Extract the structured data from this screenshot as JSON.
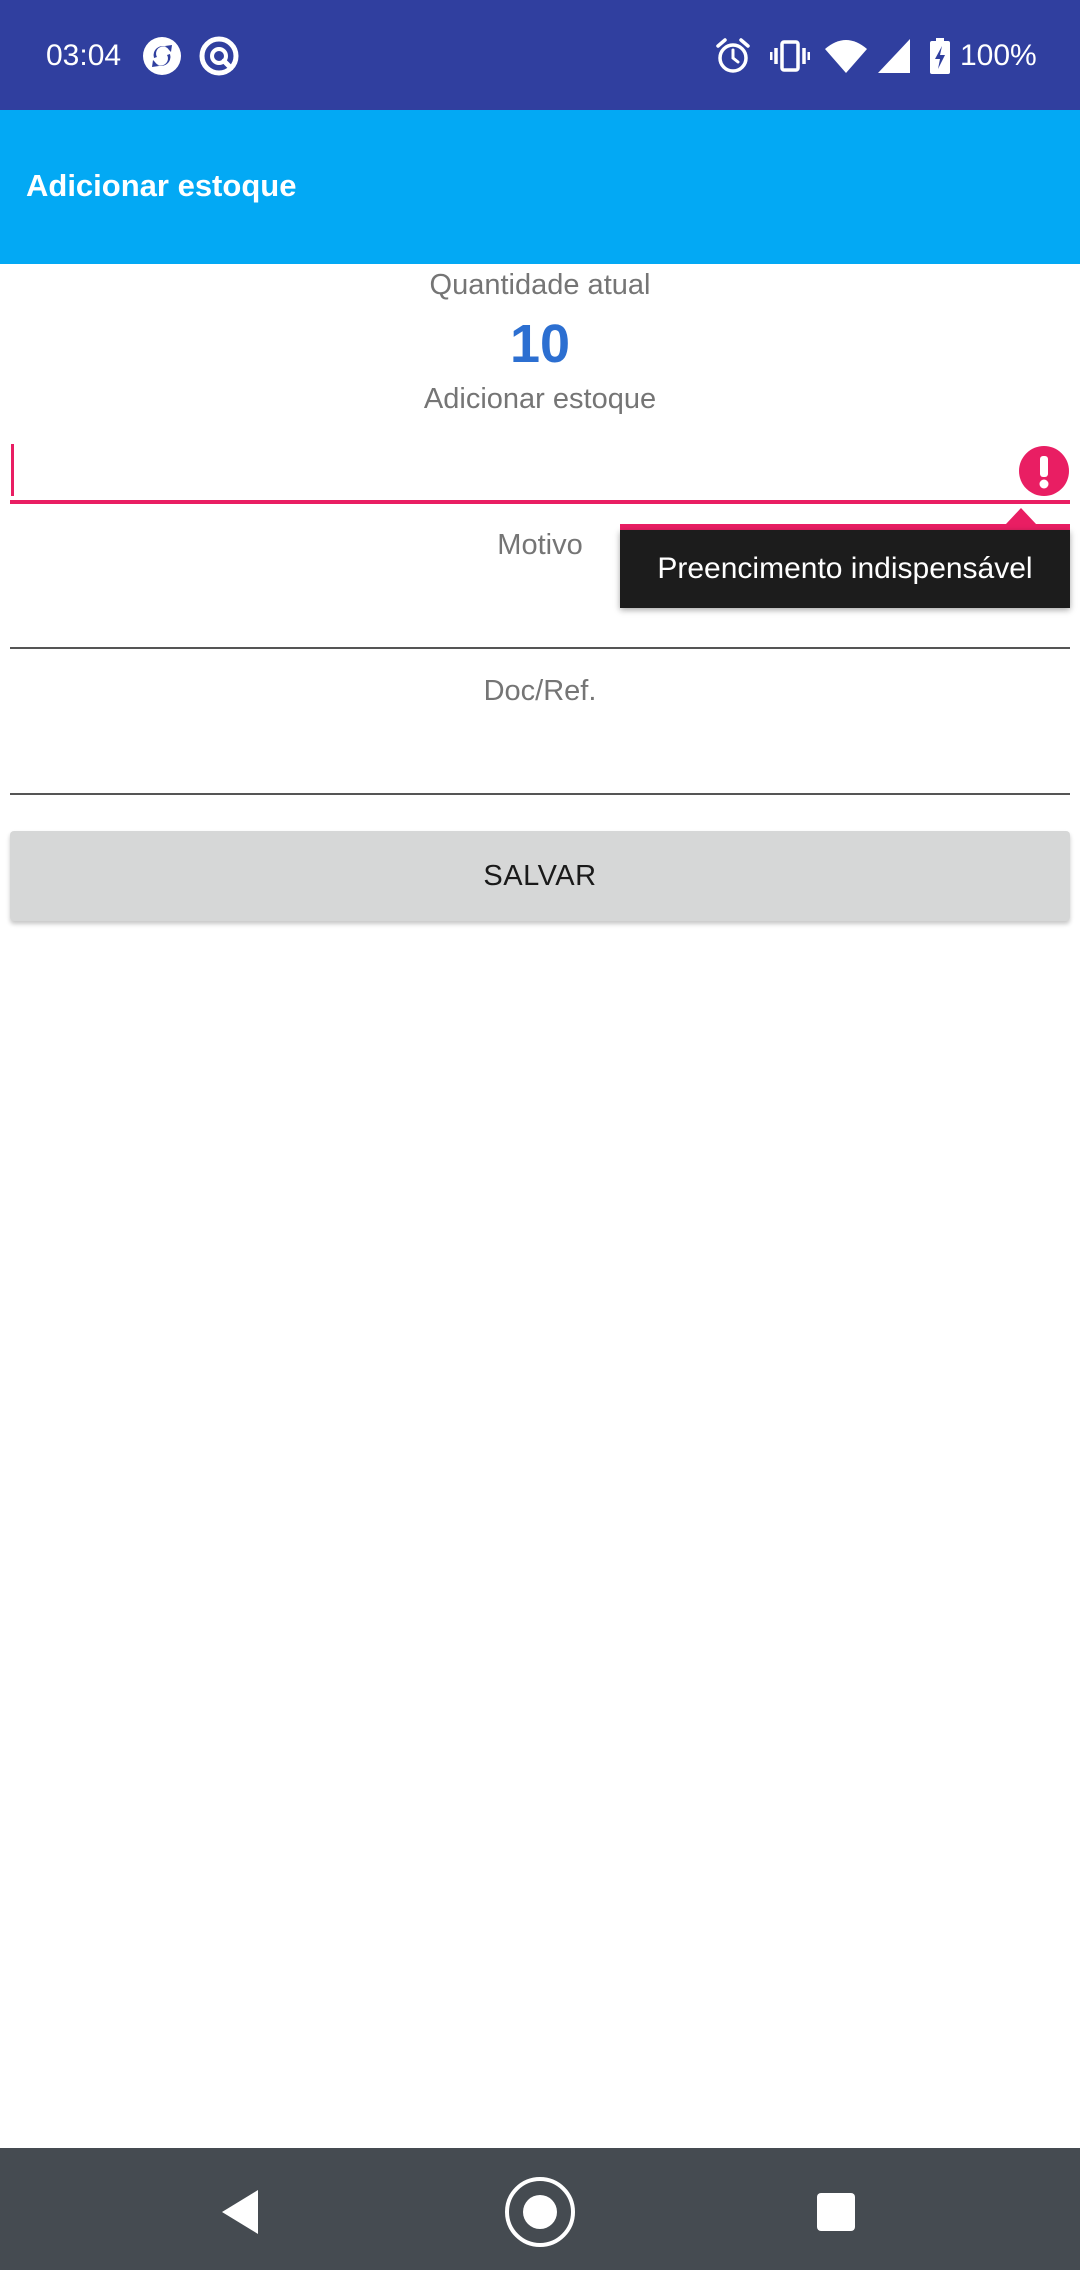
{
  "status_bar": {
    "time": "03:04",
    "battery_percent": "100%",
    "background_color": "#303f9f",
    "icons": [
      "app-sync-icon",
      "app-notification-icon",
      "alarm-icon",
      "vibrate-icon",
      "wifi-icon",
      "cell-signal-icon",
      "battery-charging-icon"
    ]
  },
  "app_bar": {
    "title": "Adicionar estoque",
    "background_color": "#03a9f4"
  },
  "form": {
    "current_quantity_label": "Quantidade atual",
    "current_quantity_value": "10",
    "add_stock_label": "Adicionar estoque",
    "add_stock_value": "",
    "error_message": "Preencimento indispensável",
    "reason_label": "Motivo",
    "reason_value": "",
    "doc_ref_label": "Doc/Ref.",
    "doc_ref_value": "",
    "save_button_label": "SALVAR",
    "error_color": "#e91e63",
    "quantity_color": "#2c6fd1"
  },
  "nav_bar": {
    "icons": [
      "back-icon",
      "home-icon",
      "recents-icon"
    ]
  }
}
